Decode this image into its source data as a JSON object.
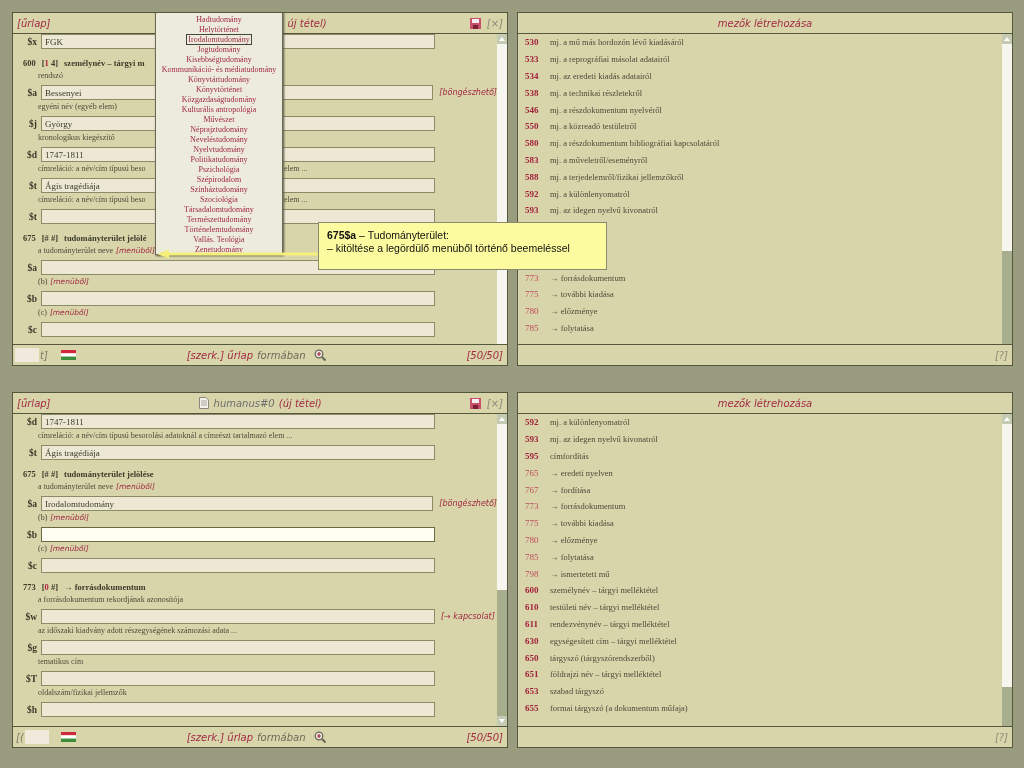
{
  "panels": [
    {
      "kind": "form",
      "header": {
        "tab": "[űrlap]",
        "covered": true,
        "title": [
          {
            "kind": "state",
            "text": "új tétel)"
          }
        ],
        "close": "[×]"
      },
      "items": [
        {
          "kind": "field",
          "code": "$x",
          "value": "FGK",
          "focused": false
        },
        {
          "kind": "heading",
          "tag": "600",
          "ind": [
            {
              "text": "[",
              "marked": false
            },
            {
              "text": "1",
              "marked": true
            },
            {
              "text": " 4]",
              "marked": false
            }
          ],
          "title": "személynév – tárgyi m"
        },
        {
          "kind": "note",
          "text": "rendszó"
        },
        {
          "kind": "field",
          "code": "$a",
          "value": "Bessenyei",
          "link": "[böngészhető]",
          "focused": false
        },
        {
          "kind": "note",
          "text": "egyéni név (egyéb elem)"
        },
        {
          "kind": "field",
          "code": "$j",
          "value": "György",
          "focused": false
        },
        {
          "kind": "note",
          "text": "kronologikus kiegészítő"
        },
        {
          "kind": "field",
          "code": "$d",
          "value": "1747-1811",
          "focused": false
        },
        {
          "kind": "note",
          "text": "címreláció: a név/cím típusú beso",
          "tail": "elem ..."
        },
        {
          "kind": "field",
          "code": "$t",
          "value": "Ágis tragédiája",
          "focused": false
        },
        {
          "kind": "note",
          "text": "címreláció: a név/cím típusú beso",
          "tail": "elem ..."
        },
        {
          "kind": "field",
          "code": "$t",
          "focused": false
        },
        {
          "kind": "heading",
          "tag": "675",
          "ind": [
            {
              "text": "[# #]",
              "marked": false
            }
          ],
          "title": "tudományterület jelölé"
        },
        {
          "kind": "note",
          "text": "a tudományterület neve",
          "hint": "[menüből]"
        },
        {
          "kind": "field",
          "code": "$a",
          "focused": false
        },
        {
          "kind": "note",
          "text": "(b)",
          "hint": "[menüből]"
        },
        {
          "kind": "field",
          "code": "$b",
          "focused": false
        },
        {
          "kind": "note",
          "text": "(c)",
          "hint": "[menüből]"
        },
        {
          "kind": "field",
          "code": "$c",
          "focused": false
        }
      ],
      "menu": {
        "items": [
          {
            "text": "Hadtudomány",
            "selected": false
          },
          {
            "text": "Helytörténet",
            "selected": false
          },
          {
            "text": "Irodalomtudomány",
            "selected": true
          },
          {
            "text": "Jogtudomány",
            "selected": false
          },
          {
            "text": "Kisebbségtudomány",
            "selected": false
          },
          {
            "text": "Kommunikáció- és médiatudomány",
            "selected": false
          },
          {
            "text": "Könyvtártudomány",
            "selected": false
          },
          {
            "text": "Könyvtörténet",
            "selected": false
          },
          {
            "text": "Közgazdaságtudomány",
            "selected": false
          },
          {
            "text": "Kulturális antropológia",
            "selected": false
          },
          {
            "text": "Művészet",
            "selected": false
          },
          {
            "text": "Néprajztudomány",
            "selected": false
          },
          {
            "text": "Neveléstudomány",
            "selected": false
          },
          {
            "text": "Nyelvtudomány",
            "selected": false
          },
          {
            "text": "Politikatudomány",
            "selected": false
          },
          {
            "text": "Pszichológia",
            "selected": false
          },
          {
            "text": "Szépirodalom",
            "selected": false
          },
          {
            "text": "Színháztudomány",
            "selected": false
          },
          {
            "text": "Szociológia",
            "selected": false
          },
          {
            "text": "Társadalomtudomány",
            "selected": false
          },
          {
            "text": "Természettudomány",
            "selected": false
          },
          {
            "text": "Történelemtudomány",
            "selected": false
          },
          {
            "text": "Vallás. Teológia",
            "selected": false
          },
          {
            "text": "Zenetudomány",
            "selected": false
          }
        ]
      },
      "footer": {
        "parts": [
          {
            "kind": "box"
          },
          {
            "kind": "text",
            "text": "t]"
          }
        ],
        "mode_link": "[szerk.] űrlap",
        "mode_text": "formában",
        "count": "[50/50]"
      }
    },
    {
      "kind": "list",
      "header": {
        "title": "mezők létrehozása"
      },
      "rows": [
        {
          "code": "530",
          "text": "mj. a mű más hordozón lévő kiadásáról",
          "bold": true
        },
        {
          "code": "533",
          "text": "mj. a reprográfiai másolat adatairól",
          "bold": true
        },
        {
          "code": "534",
          "text": "mj. az eredeti kiadás adatairól",
          "bold": true
        },
        {
          "code": "538",
          "text": "mj. a technikai részletekről",
          "bold": true
        },
        {
          "code": "546",
          "text": "mj. a részdokumentum nyelvéről",
          "bold": true
        },
        {
          "code": "550",
          "text": "mj. a közreadó testületről",
          "bold": true
        },
        {
          "code": "580",
          "text": "mj. a részdokumentum bibliográfiai kapcsolatáról",
          "bold": true
        },
        {
          "code": "583",
          "text": "mj. a műveletről/eseményről",
          "bold": true
        },
        {
          "code": "588",
          "text": "mj. a terjedelemről/fizikai jellemzőkről",
          "bold": true
        },
        {
          "code": "592",
          "text": "mj. a különlenyomatról",
          "bold": true
        },
        {
          "code": "593",
          "text": "mj. az idegen nyelvű kivonatról",
          "bold": true
        }
      ],
      "rows_below": [
        {
          "code": "773",
          "text": "→ forrásdokumentum",
          "bold": false
        },
        {
          "code": "775",
          "text": "→ további kiadása",
          "bold": false
        },
        {
          "code": "780",
          "text": "→ előzménye",
          "bold": false
        },
        {
          "code": "785",
          "text": "→ folytatása",
          "bold": false
        }
      ],
      "footer": {
        "help": "[?]"
      }
    },
    {
      "kind": "form",
      "header": {
        "tab": "[űrlap]",
        "covered": false,
        "title": [
          {
            "kind": "icon"
          },
          {
            "kind": "name",
            "text": "humanus#0"
          },
          {
            "kind": "state",
            "text": "(új tétel)"
          }
        ],
        "close": "[×]"
      },
      "items": [
        {
          "kind": "field",
          "code": "$d",
          "value": "1747-1811",
          "focused": false
        },
        {
          "kind": "note",
          "text": "címreláció: a név/cím típusú besorolási adatoknál a címrészt tartalmazó elem ..."
        },
        {
          "kind": "field",
          "code": "$t",
          "value": "Ágis tragédiája",
          "focused": false
        },
        {
          "kind": "heading",
          "tag": "675",
          "ind": [
            {
              "text": "[# #]",
              "marked": false
            }
          ],
          "title": "tudományterület jelölése"
        },
        {
          "kind": "note",
          "text": "a tudományterület neve",
          "hint": "[menüből]"
        },
        {
          "kind": "field",
          "code": "$a",
          "value": "Irodalomtudomány",
          "link": "[böngészhető]",
          "focused": false
        },
        {
          "kind": "note",
          "text": "(b)",
          "hint": "[menüből]"
        },
        {
          "kind": "field",
          "code": "$b",
          "focused": true
        },
        {
          "kind": "note",
          "text": "(c)",
          "hint": "[menüből]"
        },
        {
          "kind": "field",
          "code": "$c",
          "focused": false
        },
        {
          "kind": "heading",
          "tag": "773",
          "ind": [
            {
              "text": "[",
              "marked": false
            },
            {
              "text": "0",
              "marked": true
            },
            {
              "text": " #]",
              "marked": false
            }
          ],
          "title": "→ forrásdokumentum"
        },
        {
          "kind": "note",
          "text": "a forrásdokumentum rekordjának azonosítója"
        },
        {
          "kind": "field",
          "code": "$w",
          "link": "[→ kapcsolat]",
          "focused": false
        },
        {
          "kind": "note",
          "text": "az időszaki kiadvány adott részegységének számozási adata ..."
        },
        {
          "kind": "field",
          "code": "$g",
          "focused": false
        },
        {
          "kind": "note",
          "text": "tematikus cím"
        },
        {
          "kind": "field",
          "code": "$T",
          "focused": false
        },
        {
          "kind": "note",
          "text": "oldalszám/fizikai jellemzők"
        },
        {
          "kind": "field",
          "code": "$h",
          "focused": false
        }
      ],
      "footer": {
        "parts": [
          {
            "kind": "text",
            "text": "[("
          },
          {
            "kind": "box"
          }
        ],
        "mode_link": "[szerk.] űrlap",
        "mode_text": "formában",
        "count": "[50/50]"
      }
    },
    {
      "kind": "list",
      "header": {
        "title": "mezők létrehozása"
      },
      "rows": [
        {
          "code": "592",
          "text": "mj. a különlenyomatról",
          "bold": true
        },
        {
          "code": "593",
          "text": "mj. az idegen nyelvű kivonatról",
          "bold": true
        },
        {
          "code": "595",
          "text": "címfordítás",
          "bold": true
        },
        {
          "code": "765",
          "text": "→ eredeti nyelven",
          "bold": false
        },
        {
          "code": "767",
          "text": "→ fordítása",
          "bold": false
        },
        {
          "code": "773",
          "text": "→ forrásdokumentum",
          "bold": false
        },
        {
          "code": "775",
          "text": "→ további kiadása",
          "bold": false
        },
        {
          "code": "780",
          "text": "→ előzménye",
          "bold": false
        },
        {
          "code": "785",
          "text": "→ folytatása",
          "bold": false
        },
        {
          "code": "798",
          "text": "→ ismertetett mű",
          "bold": false
        },
        {
          "code": "600",
          "text": "személynév – tárgyi melléktétel",
          "bold": true
        },
        {
          "code": "610",
          "text": "testületi név – tárgyi melléktétel",
          "bold": true
        },
        {
          "code": "611",
          "text": "rendezvénynév – tárgyi melléktétel",
          "bold": true
        },
        {
          "code": "630",
          "text": "egységesített cím – tárgyi melléktétel",
          "bold": true
        },
        {
          "code": "650",
          "text": "tárgyszó (tárgyszórendszerből)",
          "bold": true
        },
        {
          "code": "651",
          "text": "földrajzi név – tárgyi melléktétel",
          "bold": true
        },
        {
          "code": "653",
          "text": "szabad tárgyszó",
          "bold": true
        },
        {
          "code": "655",
          "text": "formai tárgyszó (a dokumentum műfaja)",
          "bold": true
        }
      ],
      "footer": {
        "help": "[?]"
      }
    }
  ],
  "callout": {
    "title": "**675$a** – Tudományterület:",
    "text": "– kitöltése a legördülő menüből történő beemeléssel"
  }
}
